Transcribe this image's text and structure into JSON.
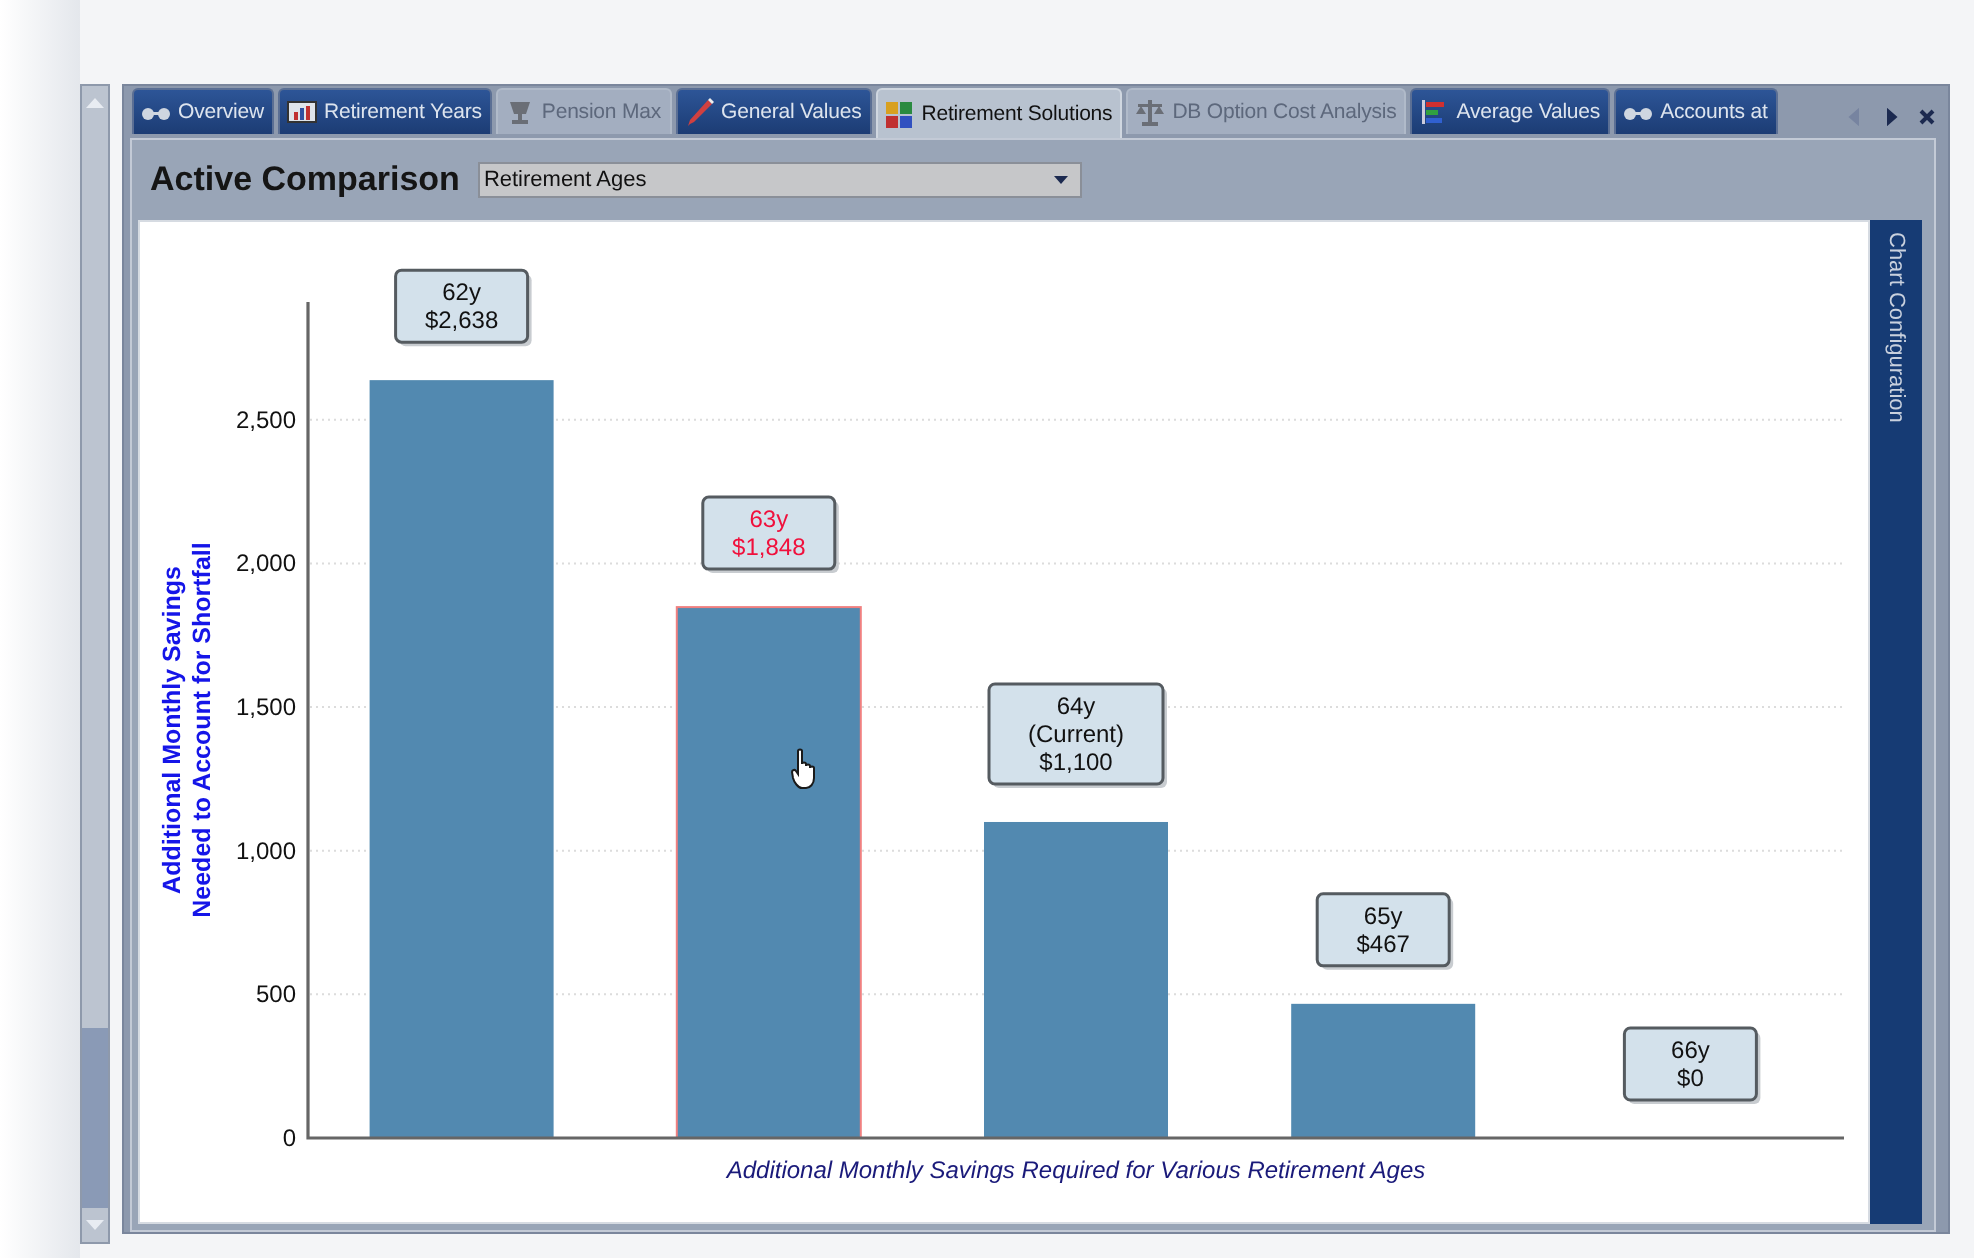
{
  "tabs": [
    {
      "label": "Overview",
      "selected": false,
      "disabled": false
    },
    {
      "label": "Retirement Years",
      "selected": false,
      "disabled": false
    },
    {
      "label": "Pension Max",
      "selected": false,
      "disabled": true
    },
    {
      "label": "General Values",
      "selected": false,
      "disabled": false
    },
    {
      "label": "Retirement Solutions",
      "selected": true,
      "disabled": false
    },
    {
      "label": "DB Option Cost Analysis",
      "selected": false,
      "disabled": true
    },
    {
      "label": "Average Values",
      "selected": false,
      "disabled": false
    },
    {
      "label": "Accounts at",
      "selected": false,
      "disabled": false
    }
  ],
  "tab_buttons": [
    {
      "kind": "prev",
      "disabled": true
    },
    {
      "kind": "next",
      "disabled": false
    },
    {
      "kind": "close",
      "disabled": false
    }
  ],
  "header": {
    "label": "Active Comparison",
    "dropdown": {
      "value": "Retirement Ages"
    }
  },
  "side_panel": {
    "label": "Chart Configuration"
  },
  "chart_data": {
    "type": "bar",
    "xlabel": "Additional Monthly Savings Required for Various Retirement Ages",
    "ylabel": "Additional Monthly Savings\nNeeded to Account for Shortfall",
    "categories": [
      "62y",
      "63y",
      "64y",
      "65y",
      "66y"
    ],
    "series": [
      {
        "color": "#5289b0",
        "values": [
          2638,
          1848,
          1100,
          467,
          0
        ]
      }
    ],
    "ylim": [
      0,
      2910
    ],
    "grid": true,
    "yticks": [
      {
        "value": 0,
        "label": "0"
      },
      {
        "value": 500,
        "label": "500"
      },
      {
        "value": 1000,
        "label": "1,000"
      },
      {
        "value": 1500,
        "label": "1,500"
      },
      {
        "value": 2000,
        "label": "2,000"
      },
      {
        "value": 2500,
        "label": "2,500"
      }
    ],
    "value_labels": [
      {
        "lines": [
          "$2,638"
        ],
        "selected": false
      },
      {
        "lines": [
          "$1,848"
        ],
        "selected": true
      },
      {
        "lines": [
          "(Current)",
          "$1,100"
        ],
        "selected": false
      },
      {
        "lines": [
          "$467"
        ],
        "selected": false
      },
      {
        "lines": [
          "$0"
        ],
        "selected": false
      }
    ]
  }
}
